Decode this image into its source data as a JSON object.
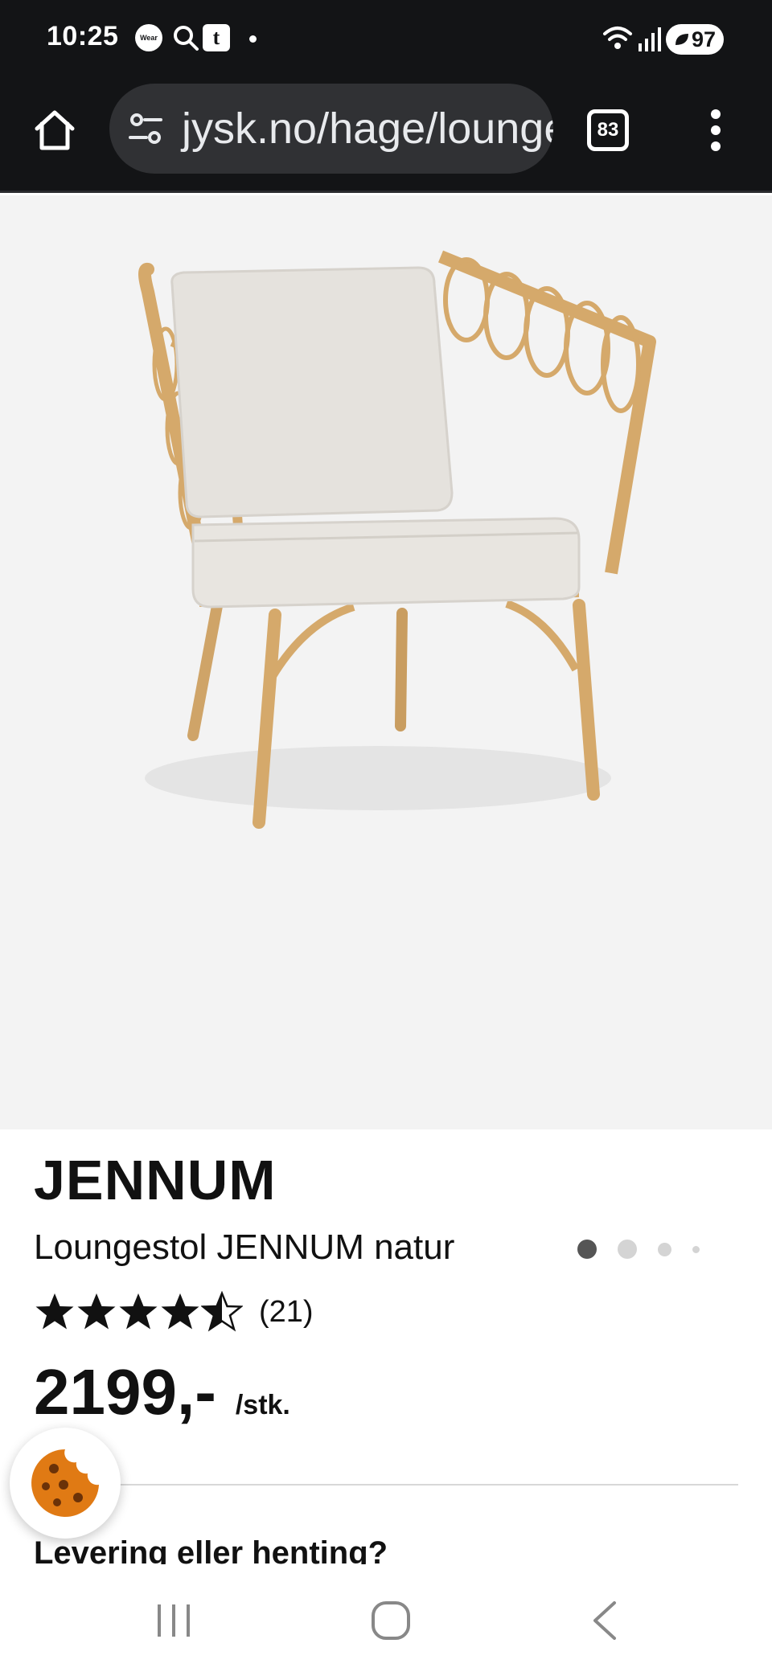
{
  "status_bar": {
    "time": "10:25",
    "wear_label": "Wear",
    "tumblr_label": "t",
    "battery": "97",
    "icons": [
      "wear-icon",
      "search-icon",
      "tumblr-icon",
      "dot-icon",
      "wifi-icon",
      "signal-icon",
      "battery-icon"
    ]
  },
  "browser": {
    "url": "jysk.no/hage/loungemobler",
    "tab_count": "83"
  },
  "product": {
    "brand": "JENNUM",
    "name": "Loungestol JENNUM natur",
    "rating": 4.5,
    "rating_max": 5,
    "review_count": "(21)",
    "price": "2199,-",
    "unit": "/stk.",
    "image_count": 4,
    "active_image": 1
  },
  "sections": {
    "delivery_heading": "Levering eller henting?"
  },
  "colors": {
    "bar_bg": "#131416",
    "url_box": "#303134",
    "image_bg": "#f3f3f3",
    "text": "#111111",
    "cookie": "#e07a14"
  }
}
